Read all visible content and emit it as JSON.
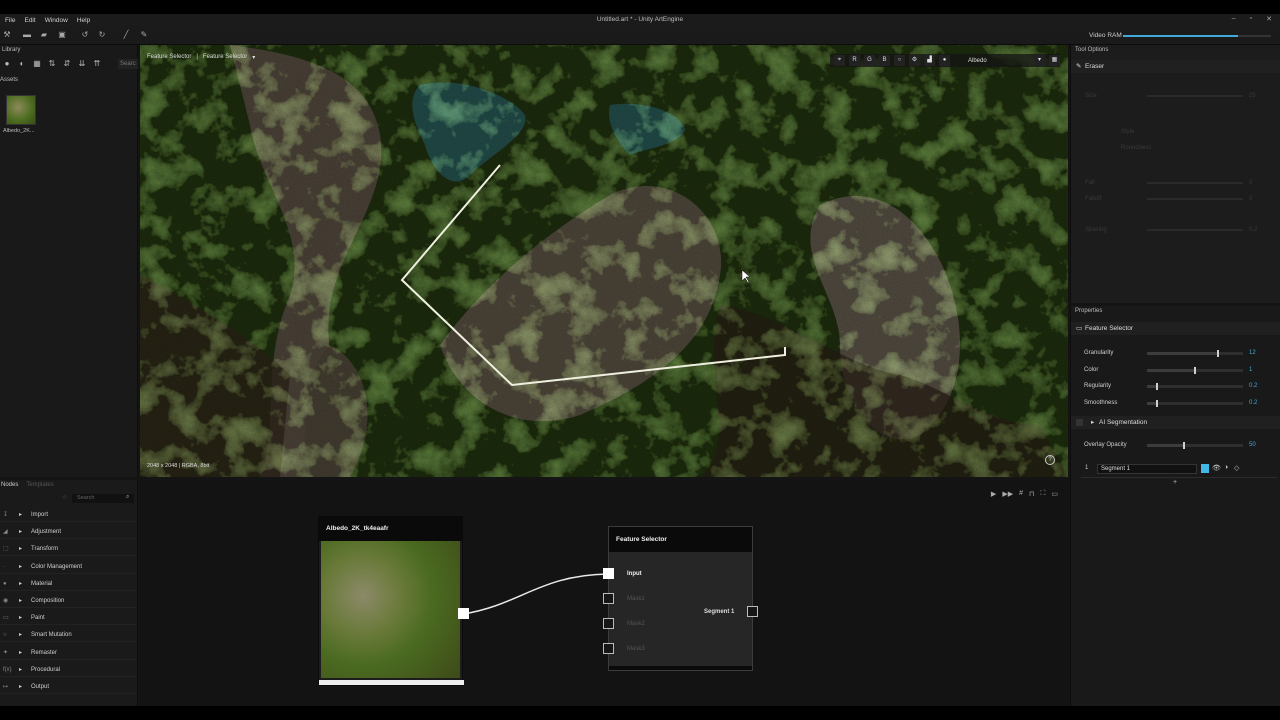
{
  "app": {
    "menu": [
      "File",
      "Edit",
      "Window",
      "Help"
    ],
    "title": "Untitled.art * - Unity ArtEngine",
    "window_controls": [
      "–",
      "▫",
      "✕"
    ]
  },
  "toolbar": {
    "vram_label": "Video RAM",
    "vram_fill": 0.78,
    "accent": "#41a8d8"
  },
  "library": {
    "title": "Library",
    "search_placeholder": "Searc",
    "assets_label": "Assets",
    "asset_name": "Albedo_2K..."
  },
  "viewport": {
    "breadcrumb": [
      "Feature Selector",
      "Feature Selector"
    ],
    "channels": [
      "R",
      "G",
      "B"
    ],
    "channel_select": "Albedo",
    "info": "2048 x 2048 | RGBA, 8bit"
  },
  "tool_options": {
    "title": "Tool Options",
    "tool": "Eraser",
    "dim_rows": [
      "Size",
      "Style",
      "Roundness",
      "Fall",
      "Falloff",
      "Spacing"
    ],
    "dim_values": [
      "25",
      "0",
      "0",
      "0.2"
    ]
  },
  "properties": {
    "title": "Properties",
    "section": "Feature Selector",
    "rows": [
      {
        "label": "Granularity",
        "value": "12",
        "level": 0.73
      },
      {
        "label": "Color",
        "value": "1",
        "level": 0.49
      },
      {
        "label": "Regularity",
        "value": "0.2",
        "level": 0.09
      },
      {
        "label": "Smoothness",
        "value": "0.2",
        "level": 0.09
      }
    ],
    "ai_label": "AI Segmentation",
    "overlay_label": "Overlay Opacity",
    "overlay_value": "50",
    "overlay_level": 0.37,
    "segment_index": "1",
    "segment_name": "Segment 1",
    "add_label": "+",
    "segment_color": "#41b8e8"
  },
  "nodes": {
    "tabs": [
      "Nodes",
      "Templates"
    ],
    "search_placeholder": "Search",
    "categories": [
      {
        "label": "Import",
        "icon": "↧"
      },
      {
        "label": "Adjustment",
        "icon": "◢"
      },
      {
        "label": "Transform",
        "icon": "⬚"
      },
      {
        "label": "Color Management",
        "icon": "·"
      },
      {
        "label": "Material",
        "icon": "●"
      },
      {
        "label": "Composition",
        "icon": "◉"
      },
      {
        "label": "Paint",
        "icon": "▭"
      },
      {
        "label": "Smart Mutation",
        "icon": "○"
      },
      {
        "label": "Remaster",
        "icon": "✦"
      },
      {
        "label": "Procedural",
        "icon": "f(x)"
      },
      {
        "label": "Output",
        "icon": "↦"
      }
    ]
  },
  "graph": {
    "albedo_node_title": "Albedo_2K_tk4eaafr",
    "fs_node_title": "Feature Selector",
    "input_label": "Input",
    "mask_labels": [
      "Mask1",
      "Mask2",
      "Mask3"
    ],
    "output_label": "Segment 1",
    "tools": [
      "▶",
      "▶▶",
      "#",
      "⊓",
      "⛶",
      "▭"
    ]
  }
}
